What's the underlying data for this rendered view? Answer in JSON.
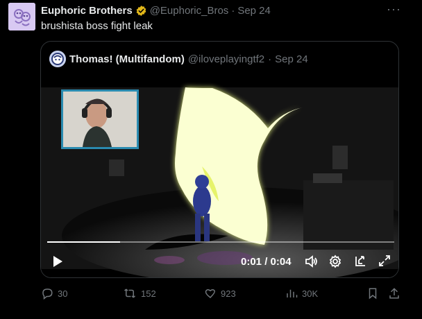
{
  "post": {
    "display_name": "Euphoric Brothers",
    "handle": "@Euphoric_Bros",
    "separator": "·",
    "date": "Sep 24",
    "more_label": "···",
    "text": "brushista boss fight leak"
  },
  "quote": {
    "display_name": "Thomas! (Multifandom)",
    "handle": "@iloveplayingtf2",
    "separator": "·",
    "date": "Sep 24"
  },
  "video": {
    "current_time": "0:01",
    "time_separator": " / ",
    "duration": "0:04",
    "progress": 0.21
  },
  "actions": {
    "replies": "30",
    "reposts": "152",
    "likes": "923",
    "views": "30K"
  },
  "icons": {
    "verified": "verified-badge-icon",
    "reply": "reply-icon",
    "repost": "repost-icon",
    "like": "heart-icon",
    "views": "views-icon",
    "bookmark": "bookmark-icon",
    "share": "share-icon",
    "play": "play-icon",
    "volume": "volume-icon",
    "settings": "gear-icon",
    "pip": "picture-in-picture-icon",
    "fullscreen": "fullscreen-icon"
  },
  "colors": {
    "background": "#000000",
    "text_primary": "#e7e9ea",
    "text_secondary": "#71767b",
    "border": "#2f3336",
    "verified_gold": "#e2b719"
  }
}
